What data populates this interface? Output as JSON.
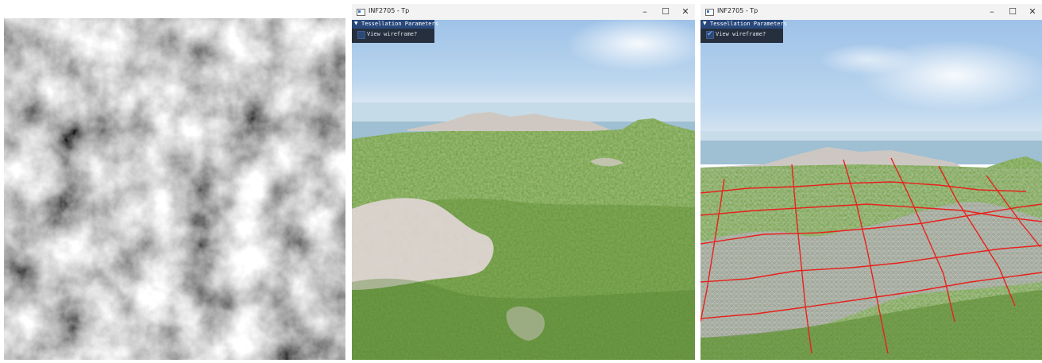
{
  "heightmap": {
    "icon": "noise-heightmap"
  },
  "windows": [
    {
      "title": "INF2705 - Tp",
      "controls": {
        "minimize": "–",
        "maximize": "☐",
        "close": "✕"
      },
      "gui": {
        "panel_title": "Tessellation Parameters",
        "toggle_arrow": "▼",
        "checkbox_label": "View wireframe?",
        "checked": false
      }
    },
    {
      "title": "INF2705 - Tp",
      "controls": {
        "minimize": "–",
        "maximize": "☐",
        "close": "✕"
      },
      "gui": {
        "panel_title": "Tessellation Parameters",
        "toggle_arrow": "▼",
        "checkbox_label": "View wireframe?",
        "checked": true,
        "check_mark": "✔"
      }
    }
  ],
  "colors": {
    "sky_top": "#9ec2e8",
    "horizon": "#cfe2ef",
    "sea": "#7aa1bf",
    "grass": "#6a9a3a",
    "snow": "#d8d0c8",
    "wire_patch": "#e8211c",
    "wire_tri": "#bcbcbc"
  }
}
